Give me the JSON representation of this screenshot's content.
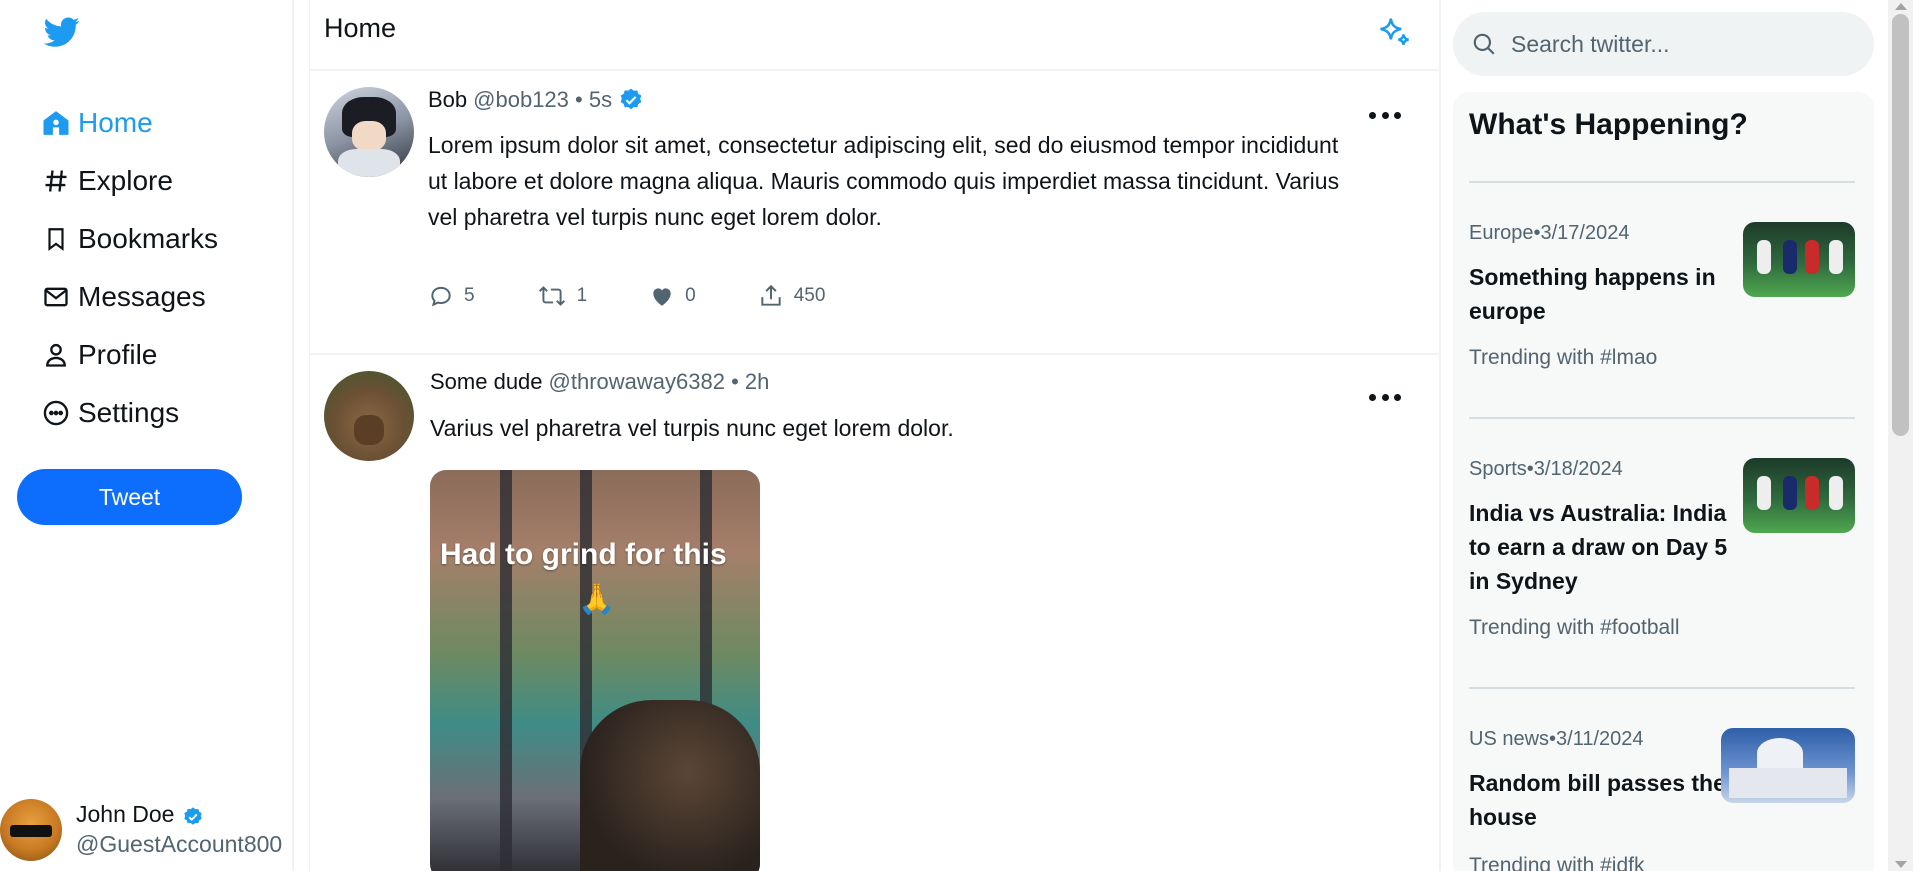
{
  "colors": {
    "accent": "#1d9bf0",
    "tweet_button": "#0d6efd",
    "text": "#0f1419",
    "muted": "#536471"
  },
  "sidebar": {
    "logo_icon": "twitter-bird-icon",
    "items": [
      {
        "label": "Home",
        "icon": "home-icon",
        "active": true
      },
      {
        "label": "Explore",
        "icon": "hashtag-icon"
      },
      {
        "label": "Bookmarks",
        "icon": "bookmark-icon"
      },
      {
        "label": "Messages",
        "icon": "envelope-icon"
      },
      {
        "label": "Profile",
        "icon": "user-icon"
      },
      {
        "label": "Settings",
        "icon": "more-circle-icon"
      }
    ],
    "tweet_button": "Tweet",
    "account": {
      "name": "John Doe",
      "handle": "@GuestAccount800",
      "verified": true
    }
  },
  "feed": {
    "title": "Home",
    "header_icon": "sparkle-icon",
    "tweets": [
      {
        "name": "Bob",
        "meta": "@bob123 • 5s",
        "verified": true,
        "text": "Lorem ipsum dolor sit amet, consectetur adipiscing elit, sed do eiusmod tempor incididunt ut labore et dolore magna aliqua. Mauris commodo quis imperdiet massa tincidunt. Varius vel pharetra vel turpis nunc eget lorem dolor.",
        "replies": "5",
        "retweets": "1",
        "likes": "0",
        "views": "450"
      },
      {
        "name": "Some dude",
        "meta": "@throwaway6382 • 2h",
        "verified": false,
        "text": "Varius vel pharetra vel turpis nunc eget lorem dolor.",
        "media_caption": "Had to grind for this",
        "media_emoji": "🙏"
      }
    ]
  },
  "right": {
    "search_placeholder": "Search twitter...",
    "happening_title": "What's Happening?",
    "trends": [
      {
        "meta": "Europe•3/17/2024",
        "title": "Something happens in europe",
        "tag": "Trending with #lmao"
      },
      {
        "meta": "Sports•3/18/2024",
        "title": "India vs Australia: India to earn a draw on Day 5 in Sydney",
        "tag": "Trending with #football"
      },
      {
        "meta": "US news•3/11/2024",
        "title": "Random bill passes the house",
        "tag": "Trending with #idfk"
      }
    ]
  }
}
